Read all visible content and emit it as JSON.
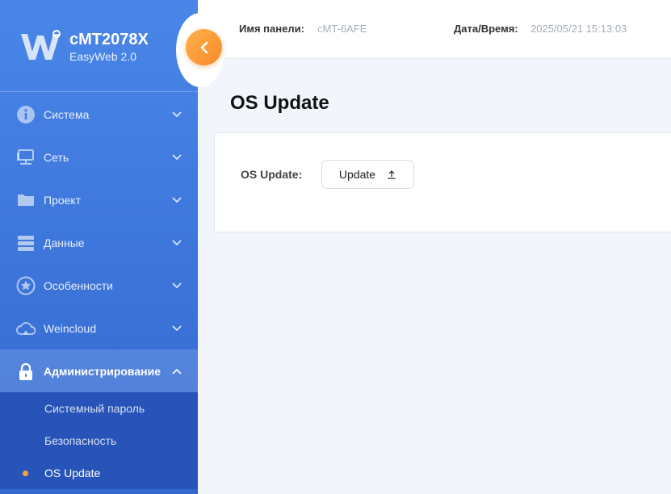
{
  "brand": {
    "title": "cMT2078X",
    "subtitle": "EasyWeb 2.0"
  },
  "header": {
    "panel_label": "Имя панели:",
    "panel_value": "cMT-6AFE",
    "datetime_label": "Дата/Время:",
    "datetime_value": "2025/05/21 15:13:03"
  },
  "sidebar": {
    "items": [
      {
        "label": "Система",
        "icon": "info-icon"
      },
      {
        "label": "Сеть",
        "icon": "network-icon"
      },
      {
        "label": "Проект",
        "icon": "folder-icon"
      },
      {
        "label": "Данные",
        "icon": "database-icon"
      },
      {
        "label": "Особенности",
        "icon": "star-icon"
      },
      {
        "label": "Weincloud",
        "icon": "cloud-icon"
      },
      {
        "label": "Администрирование",
        "icon": "lock-icon",
        "expanded": true
      }
    ],
    "submenu": [
      {
        "label": "Системный пароль"
      },
      {
        "label": "Безопасность"
      },
      {
        "label": "OS Update",
        "current": true
      }
    ]
  },
  "main": {
    "title": "OS Update",
    "form_label": "OS Update:",
    "upload_button": "Update"
  },
  "colors": {
    "sidebar": "#3f78dd",
    "accent": "#f7892a",
    "submenu": "#2853b8",
    "current_dot": "#f5a442"
  }
}
